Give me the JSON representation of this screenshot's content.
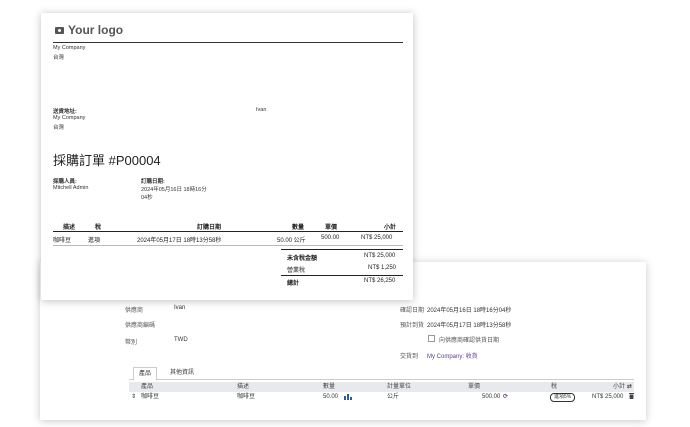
{
  "form": {
    "vendor_label": "供應商",
    "vendor_value": "Ivan",
    "vendor_ref_label": "供應商編碼",
    "currency_label": "幣別",
    "currency_value": "TWD",
    "confirm_date_label": "確認日期",
    "confirm_date_value": "2024年05月16日 18時16分04秒",
    "expected_arrival_label": "預計到貨",
    "expected_arrival_value": "2024年05月17日 18時13分58秒",
    "ask_confirm_label": "向供應商確認供貨日期",
    "deliver_to_label": "交貨到",
    "deliver_to_value": "My Company: 收貨",
    "tabs": [
      "產品",
      "其他資訊"
    ],
    "columns": [
      "產品",
      "描述",
      "數量",
      "計量單位",
      "單價",
      "稅",
      "小計"
    ],
    "row": {
      "handle": "⇕",
      "product": "咖啡豆",
      "description": "咖啡豆",
      "quantity": "50.00",
      "uom": "公斤",
      "unit_price": "500.00",
      "tax": "進項5%",
      "subtotal": "NT$ 25,000"
    }
  },
  "report": {
    "logo_text": "Your logo",
    "company_name": "My Company",
    "company_country": "台灣",
    "shipping_label": "送貨地址:",
    "shipping_company": "My Company",
    "shipping_country": "台灣",
    "vendor_name": "Ivan",
    "title": "採購訂單 #P00004",
    "buyer_label": "採購人員:",
    "buyer_value": "Mitchell Admin",
    "order_date_label": "訂購日期:",
    "order_date_line1": "2024年05月16日 18時16分",
    "order_date_line2": "04秒",
    "columns": {
      "description": "描述",
      "taxes": "稅",
      "date": "訂購日期",
      "quantity": "數量",
      "unit_price": "單價",
      "amount": "小計"
    },
    "line": {
      "description": "咖啡豆",
      "taxes": "進項",
      "date": "2024年05月17日 18時13分58秒",
      "quantity": "50.00 公斤",
      "unit_price": "500.00",
      "amount": "NT$ 25,000"
    },
    "totals": {
      "untaxed_label": "未含稅金額",
      "untaxed_value": "NT$ 25,000",
      "tax_label": "營業稅",
      "tax_value": "NT$ 1,250",
      "total_label": "總計",
      "total_value": "NT$ 26,250"
    }
  }
}
